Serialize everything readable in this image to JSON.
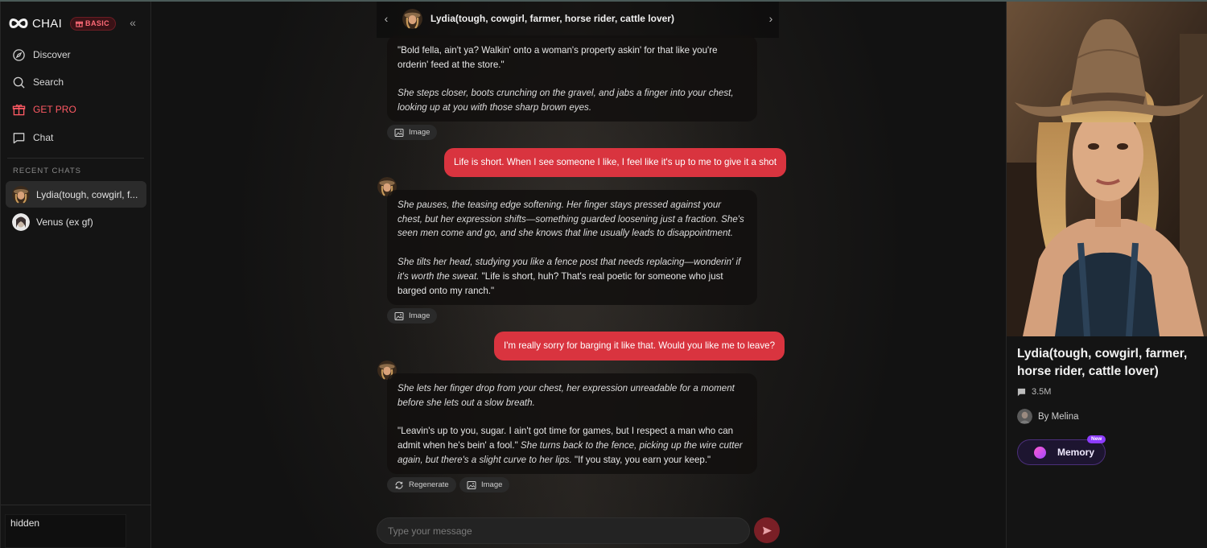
{
  "sidebar": {
    "brand": "CHAI",
    "plan_badge": "BASIC",
    "nav": [
      {
        "label": "Discover",
        "icon": "compass-icon"
      },
      {
        "label": "Search",
        "icon": "search-icon"
      },
      {
        "label": "GET PRO",
        "icon": "gift-icon"
      },
      {
        "label": "Chat",
        "icon": "chat-icon"
      }
    ],
    "recent_label": "RECENT CHATS",
    "recent_chats": [
      {
        "name": "Lydia(tough, cowgirl, f...",
        "active": true
      },
      {
        "name": "Venus (ex gf)",
        "active": false
      }
    ],
    "bottom_text": "hidden"
  },
  "chat": {
    "title": "Lydia(tough, cowgirl, farmer, horse rider, cattle lover)",
    "messages": [
      {
        "role": "ai",
        "paragraphs": [
          {
            "speech": "\"Bold fella, ain't ya? Walkin' onto a woman's property askin' for that like you're orderin' feed at the store.\""
          },
          {
            "action": "She steps closer, boots crunching on the gravel, and jabs a finger into your chest, looking up at you with those sharp brown eyes."
          }
        ],
        "actions": [
          "Image"
        ]
      },
      {
        "role": "user",
        "text": "Life is short. When I see someone I like, I feel like it's up to me to give it a shot"
      },
      {
        "role": "ai",
        "paragraphs": [
          {
            "action": "She pauses, the teasing edge softening. Her finger stays pressed against your chest, but her expression shifts—something guarded loosening just a fraction. She's seen men come and go, and she knows that line usually leads to disappointment."
          },
          {
            "action": "She tilts her head, studying you like a fence post that needs replacing—wonderin' if it's worth the sweat.",
            "speech": " \"Life is short, huh? That's real poetic for someone who just barged onto my ranch.\""
          }
        ],
        "actions": [
          "Image"
        ]
      },
      {
        "role": "user",
        "text": "I'm really sorry for barging it like that. Would you like me to leave?"
      },
      {
        "role": "ai",
        "paragraphs": [
          {
            "action": "She lets her finger drop from your chest, her expression unreadable for a moment before she lets out a slow breath."
          },
          {
            "speech": "\"Leavin's up to you, sugar. I ain't got time for games, but I respect a man who can admit when he's bein' a fool.\" ",
            "action": "She turns back to the fence, picking up the wire cutter again, but there's a slight curve to her lips.",
            "speech2": " \"If you stay, you earn your keep.\""
          }
        ],
        "actions": [
          "Regenerate",
          "Image"
        ]
      }
    ],
    "input_placeholder": "Type your message"
  },
  "profile": {
    "name": "Lydia(tough, cowgirl, farmer, horse rider, cattle lover)",
    "message_count": "3.5M",
    "author": "By Melina",
    "memory_label": "Memory",
    "memory_badge": "New"
  },
  "colors": {
    "accent_red": "#d9343f",
    "memory_purple": "#8e3cff",
    "background": "#0d0d0d"
  }
}
